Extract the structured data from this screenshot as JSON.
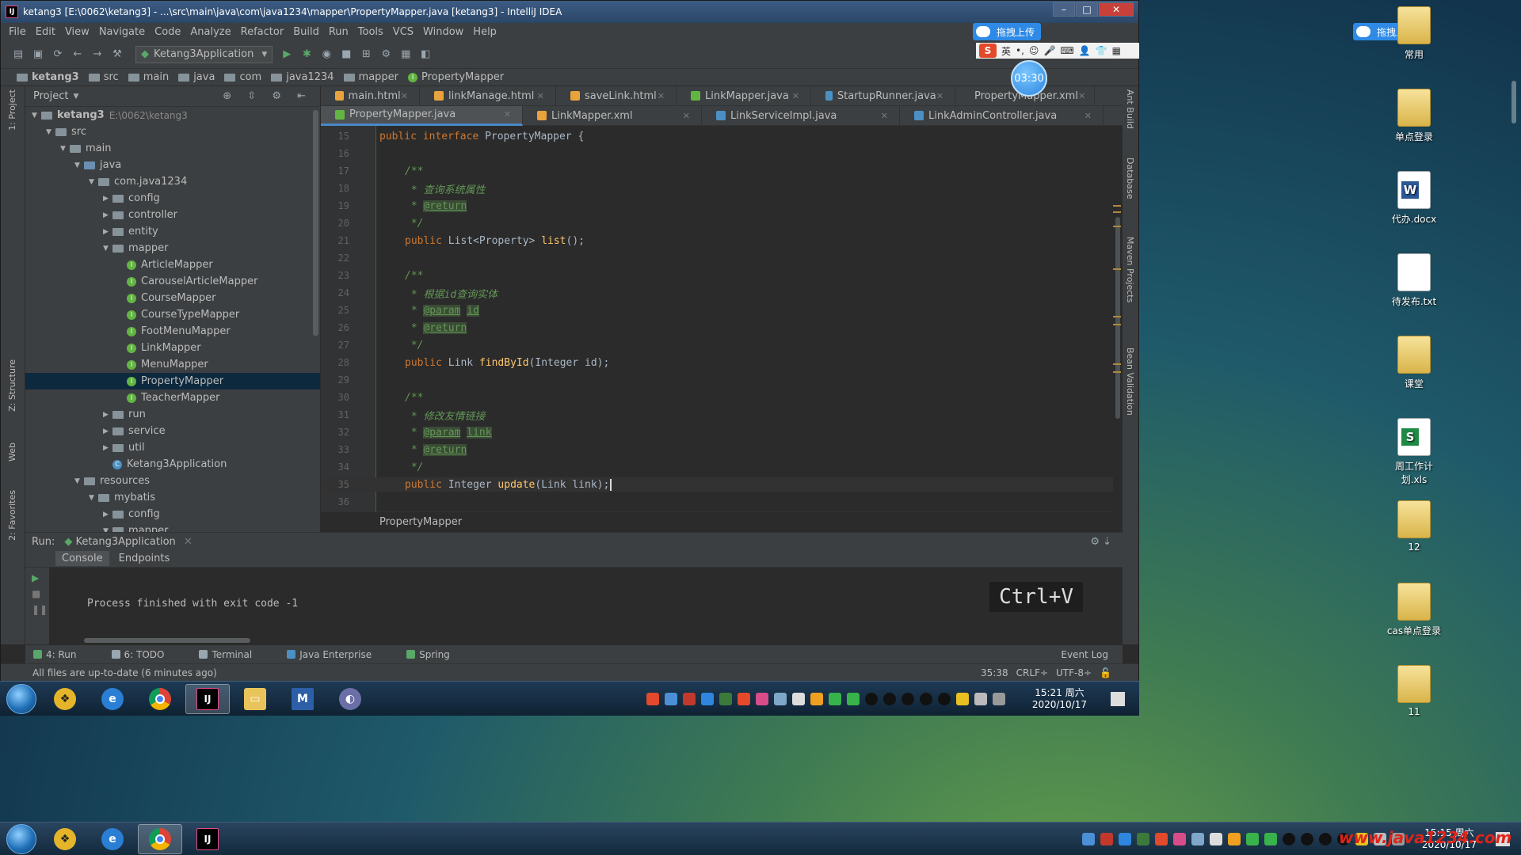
{
  "window": {
    "title": "ketang3 [E:\\0062\\ketang3] - ...\\src\\main\\java\\com\\java1234\\mapper\\PropertyMapper.java [ketang3] - IntelliJ IDEA",
    "app_icon": "IJ"
  },
  "menu": [
    "File",
    "Edit",
    "View",
    "Navigate",
    "Code",
    "Analyze",
    "Refactor",
    "Build",
    "Run",
    "Tools",
    "VCS",
    "Window",
    "Help"
  ],
  "toolbar": {
    "run_config": "Ketang3Application"
  },
  "breadcrumb": [
    "ketang3",
    "src",
    "main",
    "java",
    "com",
    "java1234",
    "mapper",
    "PropertyMapper"
  ],
  "project_panel": {
    "title": "Project",
    "tree": [
      {
        "label": "ketang3",
        "sub": "E:\\0062\\ketang3",
        "indent": 0,
        "arrow": "▼",
        "kind": "folder"
      },
      {
        "label": "src",
        "indent": 1,
        "arrow": "▼",
        "kind": "folder"
      },
      {
        "label": "main",
        "indent": 2,
        "arrow": "▼",
        "kind": "folder"
      },
      {
        "label": "java",
        "indent": 3,
        "arrow": "▼",
        "kind": "folder-blue"
      },
      {
        "label": "com.java1234",
        "indent": 4,
        "arrow": "▼",
        "kind": "folder"
      },
      {
        "label": "config",
        "indent": 5,
        "arrow": "▶",
        "kind": "folder"
      },
      {
        "label": "controller",
        "indent": 5,
        "arrow": "▶",
        "kind": "folder"
      },
      {
        "label": "entity",
        "indent": 5,
        "arrow": "▶",
        "kind": "folder"
      },
      {
        "label": "mapper",
        "indent": 5,
        "arrow": "▼",
        "kind": "folder"
      },
      {
        "label": "ArticleMapper",
        "indent": 6,
        "arrow": "",
        "kind": "interface"
      },
      {
        "label": "CarouselArticleMapper",
        "indent": 6,
        "arrow": "",
        "kind": "interface"
      },
      {
        "label": "CourseMapper",
        "indent": 6,
        "arrow": "",
        "kind": "interface"
      },
      {
        "label": "CourseTypeMapper",
        "indent": 6,
        "arrow": "",
        "kind": "interface"
      },
      {
        "label": "FootMenuMapper",
        "indent": 6,
        "arrow": "",
        "kind": "interface"
      },
      {
        "label": "LinkMapper",
        "indent": 6,
        "arrow": "",
        "kind": "interface"
      },
      {
        "label": "MenuMapper",
        "indent": 6,
        "arrow": "",
        "kind": "interface"
      },
      {
        "label": "PropertyMapper",
        "indent": 6,
        "arrow": "",
        "kind": "interface",
        "selected": true
      },
      {
        "label": "TeacherMapper",
        "indent": 6,
        "arrow": "",
        "kind": "interface"
      },
      {
        "label": "run",
        "indent": 5,
        "arrow": "▶",
        "kind": "folder"
      },
      {
        "label": "service",
        "indent": 5,
        "arrow": "▶",
        "kind": "folder"
      },
      {
        "label": "util",
        "indent": 5,
        "arrow": "▶",
        "kind": "folder"
      },
      {
        "label": "Ketang3Application",
        "indent": 5,
        "arrow": "",
        "kind": "class"
      },
      {
        "label": "resources",
        "indent": 3,
        "arrow": "▼",
        "kind": "folder"
      },
      {
        "label": "mybatis",
        "indent": 4,
        "arrow": "▼",
        "kind": "folder"
      },
      {
        "label": "config",
        "indent": 5,
        "arrow": "▶",
        "kind": "folder"
      },
      {
        "label": "mapper",
        "indent": 5,
        "arrow": "▼",
        "kind": "folder"
      }
    ]
  },
  "tabs_row1": [
    {
      "label": "main.html",
      "color": "#e8a33d"
    },
    {
      "label": "linkManage.html",
      "color": "#e8a33d"
    },
    {
      "label": "saveLink.html",
      "color": "#e8a33d"
    },
    {
      "label": "LinkMapper.java",
      "color": "#62b543"
    },
    {
      "label": "StartupRunner.java",
      "color": "#4a90c4"
    },
    {
      "label": "PropertyMapper.xml",
      "color": "#e8a33d"
    }
  ],
  "tabs_row2": [
    {
      "label": "PropertyMapper.java",
      "color": "#62b543",
      "active": true
    },
    {
      "label": "LinkMapper.xml",
      "color": "#e8a33d"
    },
    {
      "label": "LinkServiceImpl.java",
      "color": "#4a90c4"
    },
    {
      "label": "LinkAdminController.java",
      "color": "#4a90c4"
    }
  ],
  "code": [
    {
      "n": "15",
      "html": "<span class=\"kw\">public interface</span> <span class=\"ty\">PropertyMapper {</span>",
      "indent": 0
    },
    {
      "n": "16",
      "html": "",
      "indent": 0
    },
    {
      "n": "17",
      "html": "<span class=\"cm\">/**</span>",
      "indent": 1
    },
    {
      "n": "18",
      "html": "<span class=\"cm\"> * 查询系统属性</span>",
      "indent": 1
    },
    {
      "n": "19",
      "html": "<span class=\"cm\"> * </span><span class=\"tag\">@return</span>",
      "indent": 1
    },
    {
      "n": "20",
      "html": "<span class=\"cm\"> */</span>",
      "indent": 1
    },
    {
      "n": "21",
      "html": "<span class=\"kw\">public</span> <span class=\"ty\">List&lt;Property&gt; </span><span class=\"fn\">list</span><span class=\"ty\">();</span>",
      "indent": 1
    },
    {
      "n": "22",
      "html": "",
      "indent": 0
    },
    {
      "n": "23",
      "html": "<span class=\"cm\">/**</span>",
      "indent": 1
    },
    {
      "n": "24",
      "html": "<span class=\"cm\"> * 根据id查询实体</span>",
      "indent": 1
    },
    {
      "n": "25",
      "html": "<span class=\"cm\"> * </span><span class=\"tag\">@param</span><span class=\"cm\"> </span><span class=\"tag\">id</span>",
      "indent": 1
    },
    {
      "n": "26",
      "html": "<span class=\"cm\"> * </span><span class=\"tag\">@return</span>",
      "indent": 1
    },
    {
      "n": "27",
      "html": "<span class=\"cm\"> */</span>",
      "indent": 1
    },
    {
      "n": "28",
      "html": "<span class=\"kw\">public</span> <span class=\"ty\">Link </span><span class=\"fn\">findById</span><span class=\"ty\">(Integer id);</span>",
      "indent": 1
    },
    {
      "n": "29",
      "html": "",
      "indent": 0
    },
    {
      "n": "30",
      "html": "<span class=\"cm\">/**</span>",
      "indent": 1
    },
    {
      "n": "31",
      "html": "<span class=\"cm\"> * 修改友情链接</span>",
      "indent": 1
    },
    {
      "n": "32",
      "html": "<span class=\"cm\"> * </span><span class=\"tag\">@param</span><span class=\"cm\"> </span><span class=\"tag\">link</span>",
      "indent": 1
    },
    {
      "n": "33",
      "html": "<span class=\"cm\"> * </span><span class=\"tag\">@return</span>",
      "indent": 1
    },
    {
      "n": "34",
      "html": "<span class=\"cm\"> */</span>",
      "indent": 1
    },
    {
      "n": "35",
      "html": "<span class=\"kw\">public</span> <span class=\"ty\">Integer </span><span class=\"fn\">update</span><span class=\"ty\">(Link link);</span>",
      "indent": 1,
      "caret": true
    },
    {
      "n": "36",
      "html": "",
      "indent": 0
    }
  ],
  "editor_footer": "PropertyMapper",
  "run_panel": {
    "label": "Run:",
    "config_tab": "Ketang3Application",
    "subtabs": [
      "Console",
      "Endpoints"
    ],
    "console_output": "Process finished with exit code -1",
    "keycast": "Ctrl+V"
  },
  "bottom_tabs": [
    "4: Run",
    "6: TODO",
    "Terminal",
    "Java Enterprise",
    "Spring"
  ],
  "event_log": "Event Log",
  "status": {
    "message": "All files are up-to-date (6 minutes ago)",
    "position": "35:38",
    "line_sep": "CRLF÷",
    "encoding": "UTF-8÷"
  },
  "side_labels": {
    "left": [
      "1: Project",
      "Z: Structure",
      "Web",
      "2: Favorites"
    ],
    "right": [
      "Ant Build",
      "Database",
      "Maven Projects",
      "Bean Validation"
    ]
  },
  "ime": {
    "lang": "英"
  },
  "upload_label": "拖拽上传",
  "timer": "03:30",
  "taskbar1": {
    "time": "15:21 周六",
    "date": "2020/10/17"
  },
  "taskbar2": {
    "time": "15:15 周六",
    "date": "2020/10/17"
  },
  "desktop_icons": [
    {
      "label": "常用",
      "kind": "folder"
    },
    {
      "label": "单点登录",
      "kind": "folder"
    },
    {
      "label": "代办.docx",
      "kind": "word"
    },
    {
      "label": "待发布.txt",
      "kind": "txt"
    },
    {
      "label": "课堂",
      "kind": "folder"
    },
    {
      "label": "周工作计划.xls",
      "kind": "xls"
    },
    {
      "label": "12",
      "kind": "folder"
    },
    {
      "label": "cas单点登录",
      "kind": "folder"
    },
    {
      "label": "11",
      "kind": "folder"
    }
  ],
  "watermark": "www.java1234.com"
}
